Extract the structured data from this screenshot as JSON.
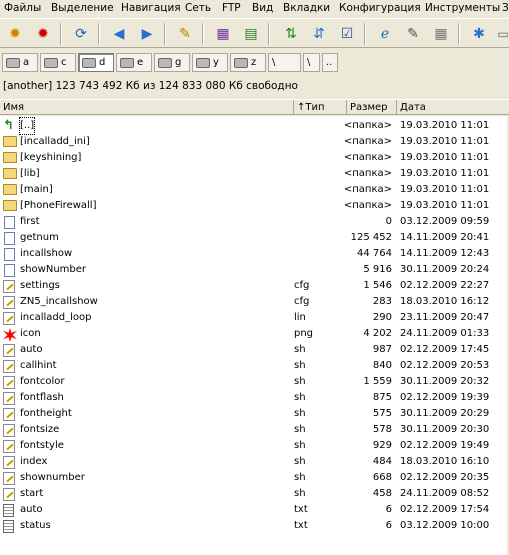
{
  "menu": [
    "Файлы",
    "Выделение",
    "Навигация",
    "Сеть",
    "FTP",
    "Вид",
    "Вкладки",
    "Конфигурация",
    "Инструменты",
    "З"
  ],
  "drives": [
    {
      "letter": "a",
      "active": false
    },
    {
      "letter": "c",
      "active": false
    },
    {
      "letter": "d",
      "active": true
    },
    {
      "letter": "e",
      "active": false
    },
    {
      "letter": "g",
      "active": false
    },
    {
      "letter": "y",
      "active": false
    },
    {
      "letter": "z",
      "active": false
    },
    {
      "letter": "\\",
      "active": false
    },
    {
      "letter": "\\",
      "active": false
    },
    {
      "letter": "..",
      "active": false
    }
  ],
  "path_info": "[another]  123 743 492 Кб из 124 833 080 Кб свободно",
  "columns": {
    "name": "Имя",
    "ext": "↑Тип",
    "size": "Размер",
    "date": "Дата"
  },
  "files": [
    {
      "icon": "up",
      "name": "[..]",
      "ext": "",
      "size": "<папка>",
      "date": "19.03.2010 11:01",
      "selected": true
    },
    {
      "icon": "folder",
      "name": "[incalladd_ini]",
      "ext": "",
      "size": "<папка>",
      "date": "19.03.2010 11:01"
    },
    {
      "icon": "folder",
      "name": "[keyshining]",
      "ext": "",
      "size": "<папка>",
      "date": "19.03.2010 11:01"
    },
    {
      "icon": "folder",
      "name": "[lib]",
      "ext": "",
      "size": "<папка>",
      "date": "19.03.2010 11:01"
    },
    {
      "icon": "folder",
      "name": "[main]",
      "ext": "",
      "size": "<папка>",
      "date": "19.03.2010 11:01"
    },
    {
      "icon": "folder",
      "name": "[PhoneFirewall]",
      "ext": "",
      "size": "<папка>",
      "date": "19.03.2010 11:01"
    },
    {
      "icon": "plain",
      "name": "first",
      "ext": "",
      "size": "0",
      "date": "03.12.2009 09:59"
    },
    {
      "icon": "plain",
      "name": "getnum",
      "ext": "",
      "size": "125 452",
      "date": "14.11.2009 20:41"
    },
    {
      "icon": "plain",
      "name": "incallshow",
      "ext": "",
      "size": "44 764",
      "date": "14.11.2009 12:43"
    },
    {
      "icon": "plain",
      "name": "showNumber",
      "ext": "",
      "size": "5 916",
      "date": "30.11.2009 20:24"
    },
    {
      "icon": "cfg",
      "name": "settings",
      "ext": "cfg",
      "size": "1 546",
      "date": "02.12.2009 22:27"
    },
    {
      "icon": "cfg",
      "name": "ZN5_incallshow",
      "ext": "cfg",
      "size": "283",
      "date": "18.03.2010 16:12"
    },
    {
      "icon": "cfg",
      "name": "incalladd_loop",
      "ext": "lin",
      "size": "290",
      "date": "23.11.2009 20:47"
    },
    {
      "icon": "burst",
      "name": "icon",
      "ext": "png",
      "size": "4 202",
      "date": "24.11.2009 01:33"
    },
    {
      "icon": "cfg",
      "name": "auto",
      "ext": "sh",
      "size": "987",
      "date": "02.12.2009 17:45"
    },
    {
      "icon": "cfg",
      "name": "callhint",
      "ext": "sh",
      "size": "840",
      "date": "02.12.2009 20:53"
    },
    {
      "icon": "cfg",
      "name": "fontcolor",
      "ext": "sh",
      "size": "1 559",
      "date": "30.11.2009 20:32"
    },
    {
      "icon": "cfg",
      "name": "fontflash",
      "ext": "sh",
      "size": "875",
      "date": "02.12.2009 19:39"
    },
    {
      "icon": "cfg",
      "name": "fontheight",
      "ext": "sh",
      "size": "575",
      "date": "30.11.2009 20:29"
    },
    {
      "icon": "cfg",
      "name": "fontsize",
      "ext": "sh",
      "size": "578",
      "date": "30.11.2009 20:30"
    },
    {
      "icon": "cfg",
      "name": "fontstyle",
      "ext": "sh",
      "size": "929",
      "date": "02.12.2009 19:49"
    },
    {
      "icon": "cfg",
      "name": "index",
      "ext": "sh",
      "size": "484",
      "date": "18.03.2010 16:10"
    },
    {
      "icon": "cfg",
      "name": "shownumber",
      "ext": "sh",
      "size": "668",
      "date": "02.12.2009 20:35"
    },
    {
      "icon": "cfg",
      "name": "start",
      "ext": "sh",
      "size": "458",
      "date": "24.11.2009 08:52"
    },
    {
      "icon": "txt",
      "name": "auto",
      "ext": "txt",
      "size": "6",
      "date": "02.12.2009 17:54"
    },
    {
      "icon": "txt",
      "name": "status",
      "ext": "txt",
      "size": "6",
      "date": "03.12.2009 10:00"
    }
  ]
}
